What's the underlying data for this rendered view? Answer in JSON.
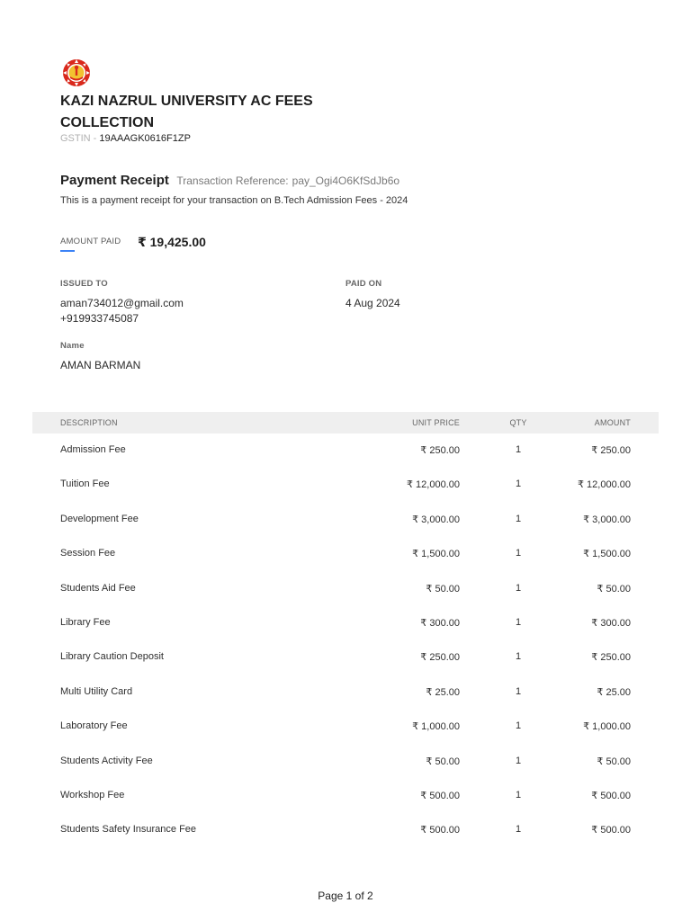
{
  "organization": {
    "name": "KAZI NAZRUL UNIVERSITY AC FEES COLLECTION",
    "gstin_label": "GSTIN -",
    "gstin": "19AAAGK0616F1ZP",
    "logo_icon": "university-emblem-icon"
  },
  "receipt": {
    "title": "Payment Receipt",
    "transaction_label": "Transaction Reference:",
    "transaction_ref": "pay_Ogi4O6KfSdJb6o",
    "description": "This is a payment receipt for your transaction on B.Tech Admission Fees - 2024"
  },
  "amount": {
    "label": "AMOUNT PAID",
    "value": "₹ 19,425.00"
  },
  "issued_to": {
    "label": "ISSUED TO",
    "email": "aman734012@gmail.com",
    "phone": "+919933745087"
  },
  "paid_on": {
    "label": "PAID ON",
    "date": "4 Aug 2024"
  },
  "name_field": {
    "label": "Name",
    "value": "AMAN BARMAN"
  },
  "table": {
    "headers": {
      "description": "DESCRIPTION",
      "unit_price": "UNIT PRICE",
      "qty": "QTY",
      "amount": "AMOUNT"
    },
    "rows": [
      {
        "description": "Admission Fee",
        "unit_price": "₹ 250.00",
        "qty": "1",
        "amount": "₹ 250.00"
      },
      {
        "description": "Tuition Fee",
        "unit_price": "₹ 12,000.00",
        "qty": "1",
        "amount": "₹ 12,000.00"
      },
      {
        "description": "Development Fee",
        "unit_price": "₹ 3,000.00",
        "qty": "1",
        "amount": "₹ 3,000.00"
      },
      {
        "description": "Session Fee",
        "unit_price": "₹ 1,500.00",
        "qty": "1",
        "amount": "₹ 1,500.00"
      },
      {
        "description": "Students Aid Fee",
        "unit_price": "₹ 50.00",
        "qty": "1",
        "amount": "₹ 50.00"
      },
      {
        "description": "Library Fee",
        "unit_price": "₹ 300.00",
        "qty": "1",
        "amount": "₹ 300.00"
      },
      {
        "description": "Library Caution Deposit",
        "unit_price": "₹ 250.00",
        "qty": "1",
        "amount": "₹ 250.00"
      },
      {
        "description": "Multi Utility Card",
        "unit_price": "₹ 25.00",
        "qty": "1",
        "amount": "₹ 25.00"
      },
      {
        "description": "Laboratory Fee",
        "unit_price": "₹ 1,000.00",
        "qty": "1",
        "amount": "₹ 1,000.00"
      },
      {
        "description": "Students Activity Fee",
        "unit_price": "₹ 50.00",
        "qty": "1",
        "amount": "₹ 50.00"
      },
      {
        "description": "Workshop Fee",
        "unit_price": "₹ 500.00",
        "qty": "1",
        "amount": "₹ 500.00"
      },
      {
        "description": "Students Safety Insurance Fee",
        "unit_price": "₹ 500.00",
        "qty": "1",
        "amount": "₹ 500.00"
      }
    ]
  },
  "footer": {
    "page": "Page 1 of 2"
  },
  "colors": {
    "accent": "#3b82f6",
    "header_bg": "#efefef",
    "logo_red": "#d9291c",
    "logo_yellow": "#f2c230"
  }
}
